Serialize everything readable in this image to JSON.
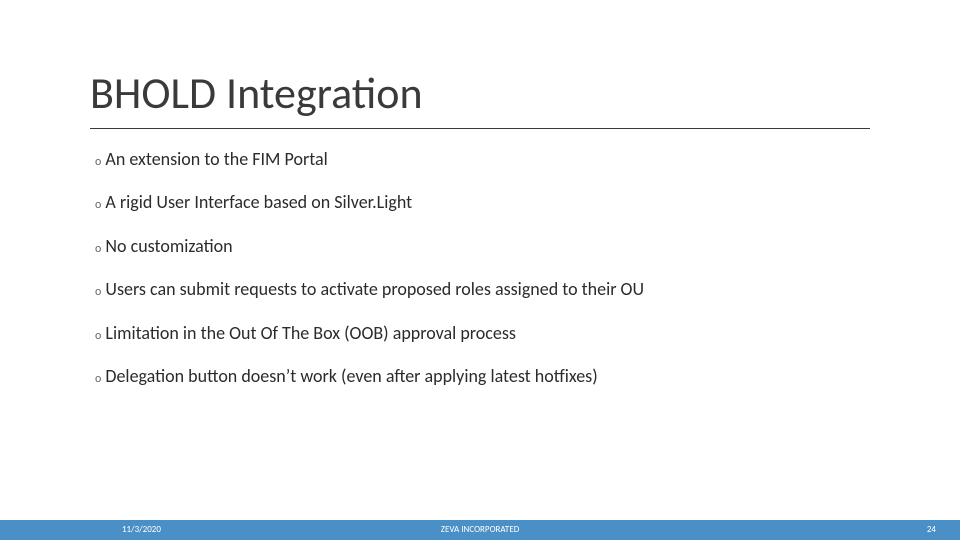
{
  "title": "BHOLD Integration",
  "bullets": [
    "An extension to the FIM Portal",
    "A rigid User Interface based on Silver.Light",
    "No customization",
    "Users can submit requests to activate proposed roles assigned to their OU",
    "Limitation in the Out Of The Box (OOB) approval process",
    "Delegation button doesn’t work (even after applying latest hotfixes)"
  ],
  "footer": {
    "date": "11/3/2020",
    "company": "ZEVA INCORPORATED",
    "page": "24"
  },
  "marker": "o"
}
